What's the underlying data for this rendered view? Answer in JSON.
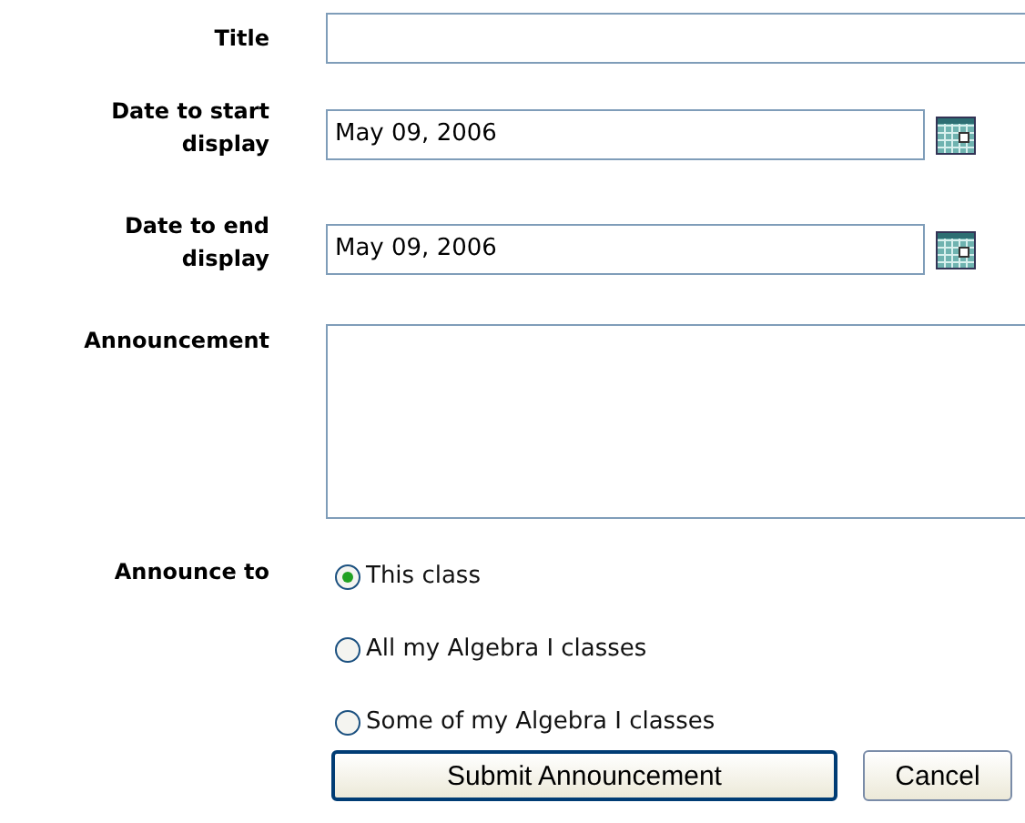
{
  "fields": [
    {
      "kind": "text",
      "label": "Title"
    },
    {
      "kind": "date",
      "label": "Date to start display",
      "value": "May 09, 2006"
    },
    {
      "kind": "date",
      "label": "Date to end display",
      "value": "May 09, 2006"
    },
    {
      "kind": "textarea",
      "label": "Announcement"
    }
  ],
  "announce_to": {
    "label": "Announce to",
    "options": [
      {
        "label": "This class",
        "selected": true
      },
      {
        "label": "All my Algebra I classes",
        "selected": false
      },
      {
        "label": "Some of my Algebra I classes",
        "selected": false
      }
    ]
  },
  "buttons": [
    "Submit Announcement",
    "Cancel"
  ]
}
